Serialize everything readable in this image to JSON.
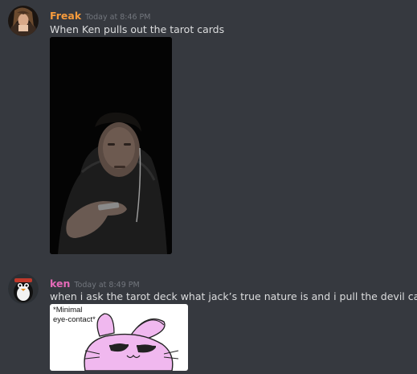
{
  "messages": [
    {
      "username": "Freak",
      "username_color": "#f69b3c",
      "timestamp": "Today at 8:46 PM",
      "text": "When Ken pulls out the tarot cards",
      "attachment": "photo"
    },
    {
      "username": "ken",
      "username_color": "#e56ab8",
      "timestamp": "Today at 8:49 PM",
      "text": "when i ask the tarot deck what jack’s true nature is and i pull the devil card",
      "attachment": "meme",
      "attachment_caption": "*Minimal\neye-contact*"
    }
  ]
}
